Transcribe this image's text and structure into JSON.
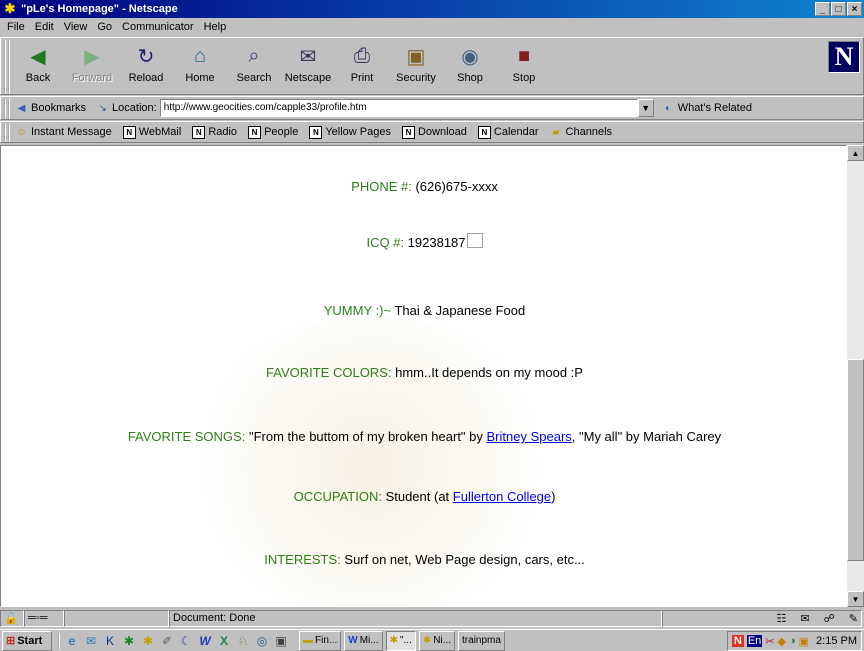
{
  "window": {
    "title": "\"pLe's Homepage\" - Netscape",
    "controls": [
      "_",
      "□",
      "×"
    ]
  },
  "menu": [
    "File",
    "Edit",
    "View",
    "Go",
    "Communicator",
    "Help"
  ],
  "toolbar": [
    {
      "label": "Back",
      "icon": "back-arrow-icon",
      "glyph": "◀",
      "color": "#1f7a1f",
      "disabled": false
    },
    {
      "label": "Forward",
      "icon": "forward-arrow-icon",
      "glyph": "▶",
      "color": "#7fb07f",
      "disabled": true
    },
    {
      "label": "Reload",
      "icon": "reload-icon",
      "glyph": "↻",
      "color": "#202070",
      "disabled": false
    },
    {
      "label": "Home",
      "icon": "home-icon",
      "glyph": "⌂",
      "color": "#1f6f8f",
      "disabled": false
    },
    {
      "label": "Search",
      "icon": "search-icon",
      "glyph": "⌕",
      "color": "#404080",
      "disabled": false
    },
    {
      "label": "Netscape",
      "icon": "netscape-icon",
      "glyph": "✉",
      "color": "#303050",
      "disabled": false
    },
    {
      "label": "Print",
      "icon": "print-icon",
      "glyph": "⎙",
      "color": "#303060",
      "disabled": false
    },
    {
      "label": "Security",
      "icon": "security-lock-icon",
      "glyph": "▣",
      "color": "#806020",
      "disabled": false
    },
    {
      "label": "Shop",
      "icon": "shop-icon",
      "glyph": "◉",
      "color": "#406080",
      "disabled": false
    },
    {
      "label": "Stop",
      "icon": "stop-icon",
      "glyph": "■",
      "color": "#802020",
      "disabled": false
    }
  ],
  "brand_letter": "N",
  "location": {
    "bookmarks_label": "Bookmarks",
    "location_label": "Location:",
    "url": "http://www.geocities.com/capple33/profile.htm",
    "whats_related": "What's Related"
  },
  "personal_toolbar": [
    {
      "label": "Instant Message",
      "icon": "instant-message-icon"
    },
    {
      "label": "WebMail",
      "icon": "bookmark-page-icon"
    },
    {
      "label": "Radio",
      "icon": "bookmark-page-icon"
    },
    {
      "label": "People",
      "icon": "bookmark-page-icon"
    },
    {
      "label": "Yellow Pages",
      "icon": "bookmark-page-icon"
    },
    {
      "label": "Download",
      "icon": "bookmark-page-icon"
    },
    {
      "label": "Calendar",
      "icon": "bookmark-page-icon"
    },
    {
      "label": "Channels",
      "icon": "channels-folder-icon"
    }
  ],
  "profile": {
    "phone_label": "PHONE #:",
    "phone_value": " (626)675-xxxx",
    "icq_label": "ICQ #:",
    "icq_value": " 19238187",
    "yummy_label": "YUMMY :)~",
    "yummy_value": " Thai & Japanese Food",
    "colors_label": "FAVORITE COLORS:",
    "colors_value": " hmm..It depends on my mood :P",
    "songs_label": "FAVORITE SONGS:",
    "songs_value_1": " \"From the buttom of my broken heart\" by ",
    "songs_link": "Britney Spears",
    "songs_value_2": ", \"My all\" by Mariah Carey",
    "occupation_label": "OCCUPATION:",
    "occupation_value_1": " Student (at ",
    "occupation_link": "Fullerton College",
    "occupation_value_2": ")",
    "interests_label": "INTERESTS:",
    "interests_value": " Surf on net, Web Page design, cars, etc..."
  },
  "status": {
    "text": "Document: Done"
  },
  "taskbar": {
    "start": "Start",
    "tasks": [
      "Fin...",
      "Mi...",
      "\"...",
      "Ni...",
      "trainpma"
    ],
    "clock": "2:15 PM",
    "lang": "En"
  },
  "colors": {
    "label_green": "#2e7d1a",
    "link_blue": "#0000ee",
    "titlebar": "#000080"
  }
}
